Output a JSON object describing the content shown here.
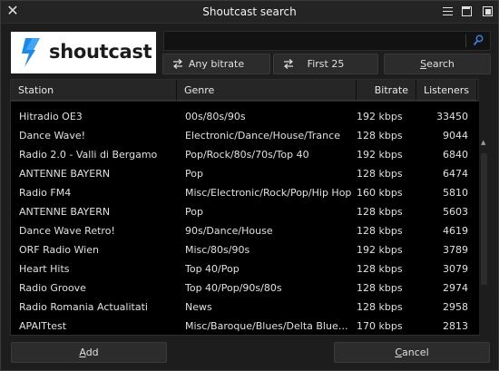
{
  "window": {
    "title": "Shoutcast search"
  },
  "logo": {
    "text": "shoutcast"
  },
  "search": {
    "value": "",
    "placeholder": ""
  },
  "buttons": {
    "bitrate": "Any bitrate",
    "limit": "First 25",
    "search_u": "S",
    "search_rest": "earch",
    "add_u": "A",
    "add_rest": "dd",
    "cancel_u": "C",
    "cancel_rest": "ancel"
  },
  "table": {
    "columns": {
      "station": "Station",
      "genre": "Genre",
      "bitrate": "Bitrate",
      "listeners": "Listeners"
    },
    "rows": [
      {
        "station": "Hitradio OE3",
        "genre": "00s/80s/90s",
        "bitrate": "192 kbps",
        "listeners": "33450"
      },
      {
        "station": "Dance Wave!",
        "genre": "Electronic/Dance/House/Trance",
        "bitrate": "128 kbps",
        "listeners": "9044"
      },
      {
        "station": "Radio 2.0 - Valli di Bergamo",
        "genre": "Pop/Rock/80s/70s/Top 40",
        "bitrate": "192 kbps",
        "listeners": "6840"
      },
      {
        "station": "ANTENNE BAYERN",
        "genre": "Pop",
        "bitrate": "128 kbps",
        "listeners": "6474"
      },
      {
        "station": "Radio FM4",
        "genre": "Misc/Electronic/Rock/Pop/Hip Hop",
        "bitrate": "160 kbps",
        "listeners": "5810"
      },
      {
        "station": "ANTENNE BAYERN",
        "genre": "Pop",
        "bitrate": "128 kbps",
        "listeners": "5603"
      },
      {
        "station": "Dance Wave Retro!",
        "genre": "90s/Dance/House",
        "bitrate": "128 kbps",
        "listeners": "4619"
      },
      {
        "station": "ORF Radio Wien",
        "genre": "Misc/80s/90s",
        "bitrate": "192 kbps",
        "listeners": "3789"
      },
      {
        "station": "Heart Hits",
        "genre": "Top 40/Pop",
        "bitrate": "128 kbps",
        "listeners": "3079"
      },
      {
        "station": "Radio Groove",
        "genre": "Top 40/Pop/90s/80s",
        "bitrate": "128 kbps",
        "listeners": "2974"
      },
      {
        "station": "Radio Romania Actualitati",
        "genre": "News",
        "bitrate": "128 kbps",
        "listeners": "2958"
      },
      {
        "station": "APAITtest",
        "genre": "Misc/Baroque/Blues/Delta Blue…",
        "bitrate": "170 kbps",
        "listeners": "2813"
      }
    ]
  },
  "icons": {
    "close": "close-icon",
    "menu": "hamburger-menu-icon",
    "maximize": "window-maximize-icon",
    "restore": "window-restore-icon",
    "search": "search-icon",
    "swap": "swap-arrows-icon"
  },
  "colors": {
    "background": "#1d1d1d",
    "accent": "#2f6fd8",
    "logo_blue": "#1e88e5"
  }
}
